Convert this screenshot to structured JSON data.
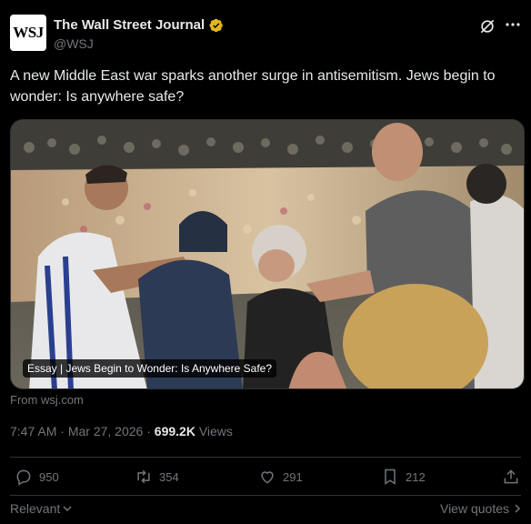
{
  "account": {
    "logo_text": "WSJ",
    "display_name": "The Wall Street Journal",
    "handle": "@WSJ"
  },
  "tweet": {
    "text": "A new Middle East war sparks another surge in antisemitism. Jews begin to wonder: Is anywhere safe?"
  },
  "media": {
    "caption": "Essay | Jews Begin to Wonder: Is Anywhere Safe?",
    "source": "From wsj.com"
  },
  "meta": {
    "time": "7:47 AM",
    "separator": " · ",
    "date": "Mar 27, 2026",
    "views_count": "699.2K",
    "views_label": " Views"
  },
  "actions": {
    "replies": "950",
    "reposts": "354",
    "likes": "291",
    "bookmarks": "212"
  },
  "footer": {
    "sort_label": "Relevant",
    "view_quotes": "View quotes"
  },
  "colors": {
    "background": "#000000",
    "text_primary": "#e7e9ea",
    "text_secondary": "#71767b",
    "divider": "#2f3336",
    "verified_badge": "#e2b719"
  },
  "icons": [
    "verified-badge-icon",
    "grok-icon",
    "more-icon",
    "reply-icon",
    "repost-icon",
    "like-icon",
    "bookmark-icon",
    "share-icon",
    "chevron-down-icon",
    "chevron-right-icon"
  ]
}
